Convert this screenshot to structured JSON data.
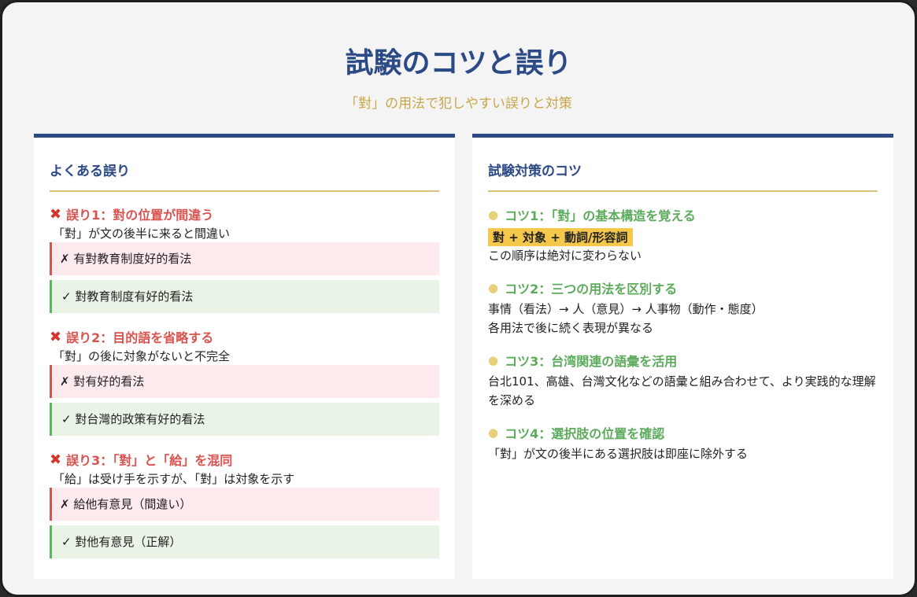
{
  "header": {
    "title": "試験のコツと誤り",
    "subtitle": "「對」の用法で犯しやすい誤りと対策"
  },
  "mistakes": {
    "heading": "よくある誤り",
    "items": [
      {
        "title": "誤り1：對の位置が間違う",
        "desc": "「對」が文の後半に来ると間違い",
        "wrong": "✗ 有對教育制度好的看法",
        "right": "✓ 對教育制度有好的看法"
      },
      {
        "title": "誤り2：目的語を省略する",
        "desc": "「對」の後に対象がないと不完全",
        "wrong": "✗ 對有好的看法",
        "right": "✓ 對台灣的政策有好的看法"
      },
      {
        "title": "誤り3：「對」と「給」を混同",
        "desc": "「給」は受け手を示すが、「對」は対象を示す",
        "wrong": "✗ 給他有意見（間違い）",
        "right": "✓ 對他有意見（正解）"
      }
    ]
  },
  "tips": {
    "heading": "試験対策のコツ",
    "items": [
      {
        "title": "コツ1：「對」の基本構造を覚える",
        "formula": "對 + 対象 + 動詞/形容詞",
        "desc": "この順序は絶対に変わらない"
      },
      {
        "title": "コツ2：三つの用法を区別する",
        "desc": "事情（看法）→ 人（意見）→ 人事物（動作・態度）",
        "desc2": "各用法で後に続く表現が異なる"
      },
      {
        "title": "コツ3：台湾関連の語彙を活用",
        "desc": "台北101、高雄、台灣文化などの語彙と組み合わせて、より実践的な理解を深める"
      },
      {
        "title": "コツ4：選択肢の位置を確認",
        "desc": "「對」が文の後半にある選択肢は即座に除外する"
      }
    ]
  },
  "icons": {
    "mistake": "❌",
    "tip": "💡"
  }
}
